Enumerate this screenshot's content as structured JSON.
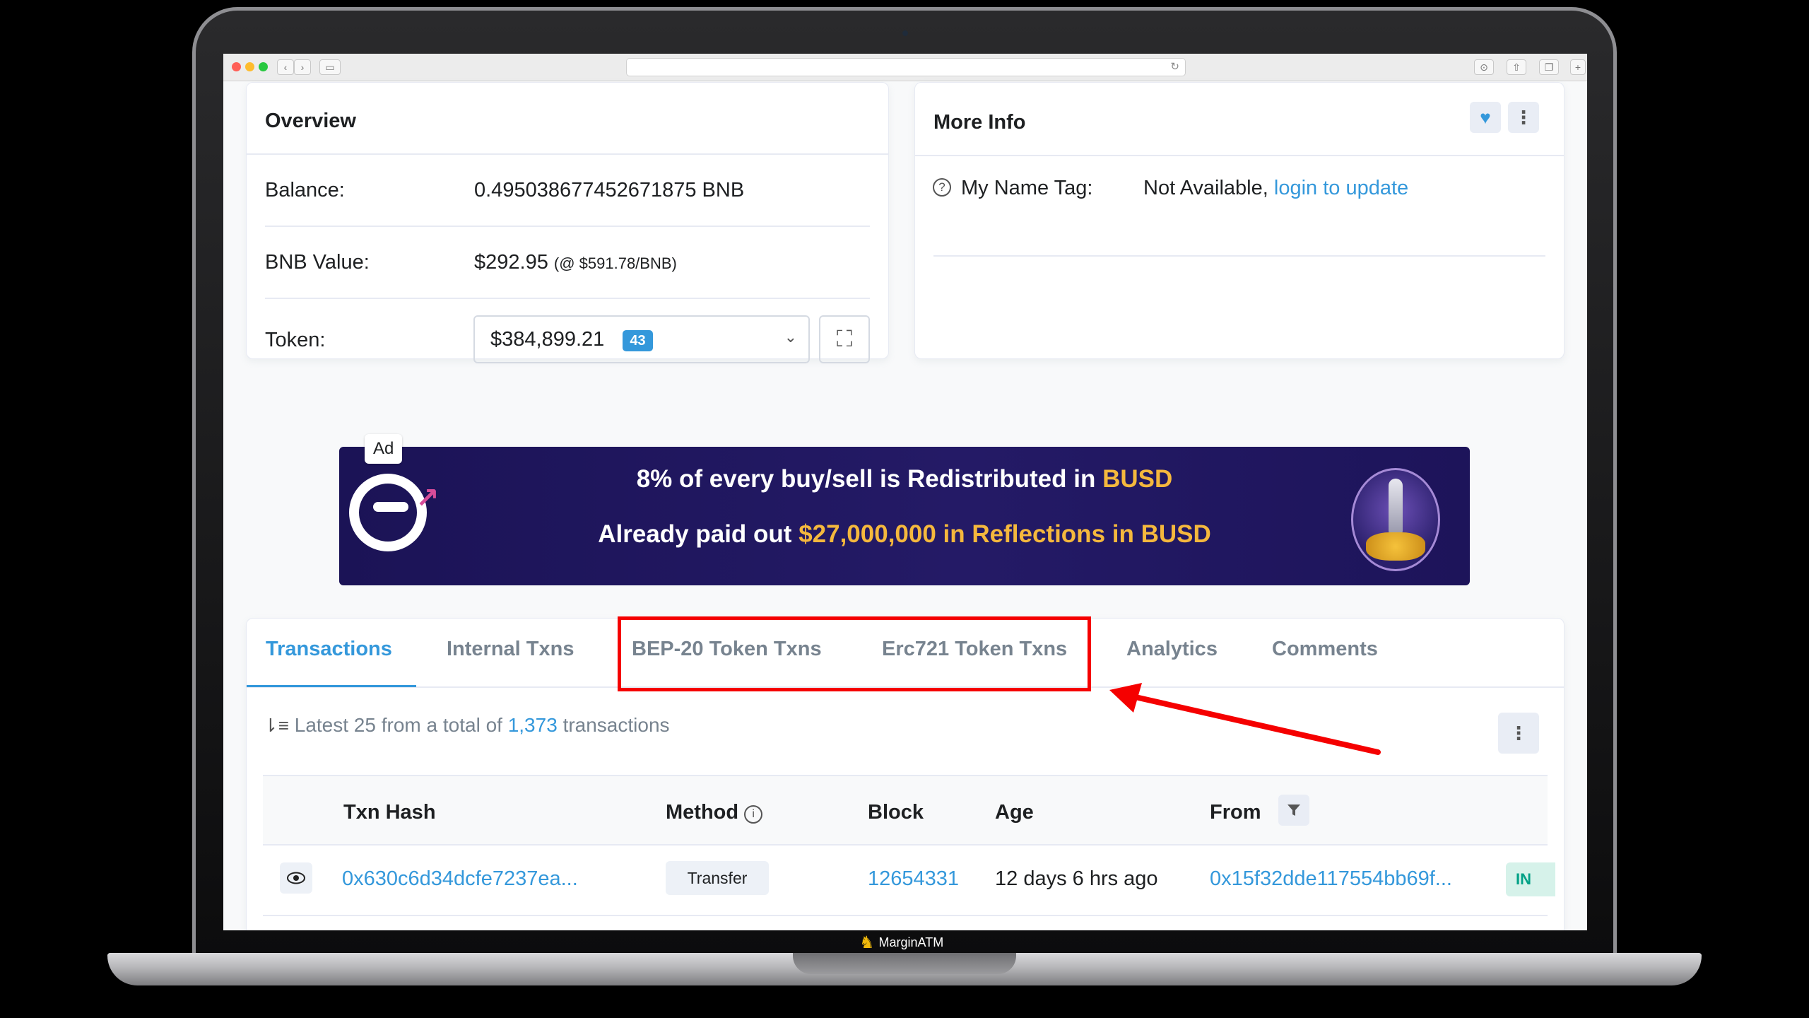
{
  "overview": {
    "title": "Overview",
    "balance_label": "Balance:",
    "balance_value": "0.495038677452671875 BNB",
    "bnb_value_label": "BNB Value:",
    "bnb_value": "$292.95",
    "bnb_rate": "(@ $591.78/BNB)",
    "token_label": "Token:",
    "token_value": "$384,899.21",
    "token_count": "43"
  },
  "more_info": {
    "title": "More Info",
    "name_tag_label": "My Name Tag:",
    "name_tag_value": "Not Available,",
    "login_link": "login to update"
  },
  "ad": {
    "tag": "Ad",
    "line1_prefix": "8% of every buy/sell is Redistributed in",
    "line1_highlight": "BUSD",
    "line2_prefix": "Already paid out",
    "line2_highlight": "$27,000,000 in Reflections in BUSD"
  },
  "tabs": [
    {
      "label": "Transactions"
    },
    {
      "label": "Internal Txns"
    },
    {
      "label": "BEP-20 Token Txns"
    },
    {
      "label": "Erc721 Token Txns"
    },
    {
      "label": "Analytics"
    },
    {
      "label": "Comments"
    }
  ],
  "summary": {
    "prefix": "Latest 25 from a total of",
    "count": "1,373",
    "suffix": "transactions"
  },
  "table": {
    "headers": {
      "txn_hash": "Txn Hash",
      "method": "Method",
      "block": "Block",
      "age": "Age",
      "from": "From"
    },
    "rows": [
      {
        "txn_hash": "0x630c6d34dcfe7237ea...",
        "method": "Transfer",
        "block": "12654331",
        "age": "12 days 6 hrs ago",
        "from": "0x15f32dde117554bb69f...",
        "direction": "IN"
      }
    ]
  },
  "branding": {
    "name": "MarginATM"
  },
  "colors": {
    "accent": "#3498db",
    "highlight_red": "#f50000",
    "ad_gold": "#f5b83d",
    "ad_background": "#1b1356"
  },
  "icons": {
    "heart": "heart-icon",
    "more": "more-vertical-icon",
    "help": "question-circle-icon",
    "expand": "expand-icon",
    "sort": "sort-icon",
    "info": "info-icon",
    "filter": "filter-icon",
    "eye": "eye-icon",
    "chevron": "chevron-down-icon"
  }
}
